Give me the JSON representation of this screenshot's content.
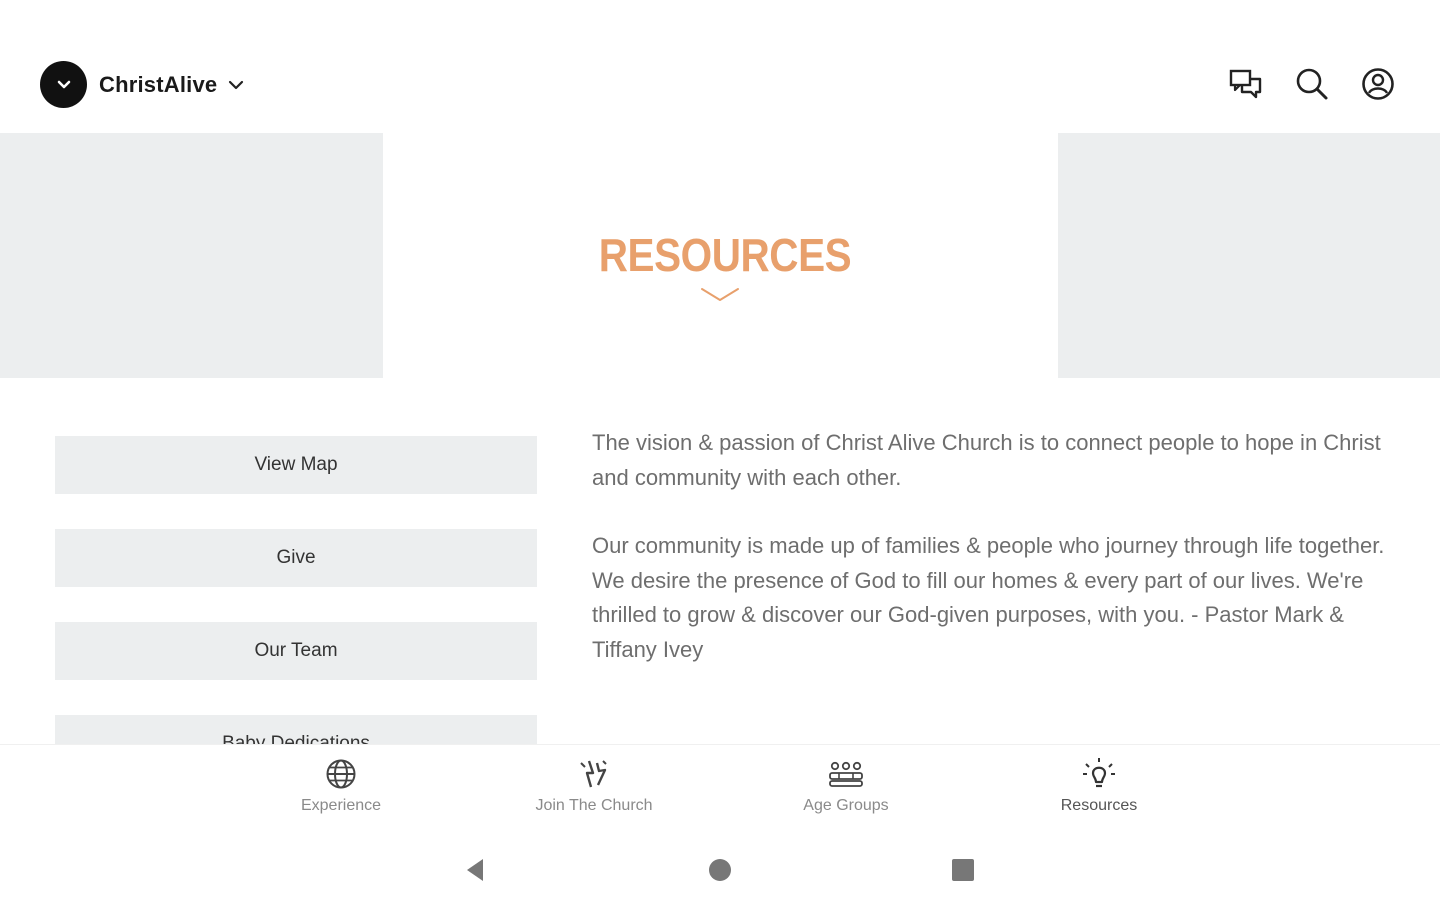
{
  "header": {
    "app_name": "ChristAlive",
    "icons": [
      "chat-icon",
      "search-icon",
      "account-icon"
    ]
  },
  "hero": {
    "title": "RESOURCES",
    "accent_color": "#e8a06c"
  },
  "resources": {
    "buttons": [
      "View Map",
      "Give",
      "Our Team",
      "Baby Dedications"
    ]
  },
  "description": {
    "paragraphs": [
      "The vision & passion of Christ Alive Church is to connect people to hope in Christ and community with each other.",
      "Our community is made up of families & people who journey through life together. We desire the presence of God to fill our homes & every part of our lives. We're thrilled to grow & discover our God-given purposes, with you. - Pastor Mark & Tiffany Ivey"
    ]
  },
  "bottom_nav": {
    "items": [
      {
        "label": "Experience",
        "icon": "globe-icon"
      },
      {
        "label": "Join The Church",
        "icon": "sparkle-icon"
      },
      {
        "label": "Age Groups",
        "icon": "group-icon"
      },
      {
        "label": "Resources",
        "icon": "lightbulb-icon"
      }
    ],
    "active": "Resources"
  },
  "system_nav": {
    "buttons": [
      "back",
      "home",
      "recents"
    ]
  }
}
